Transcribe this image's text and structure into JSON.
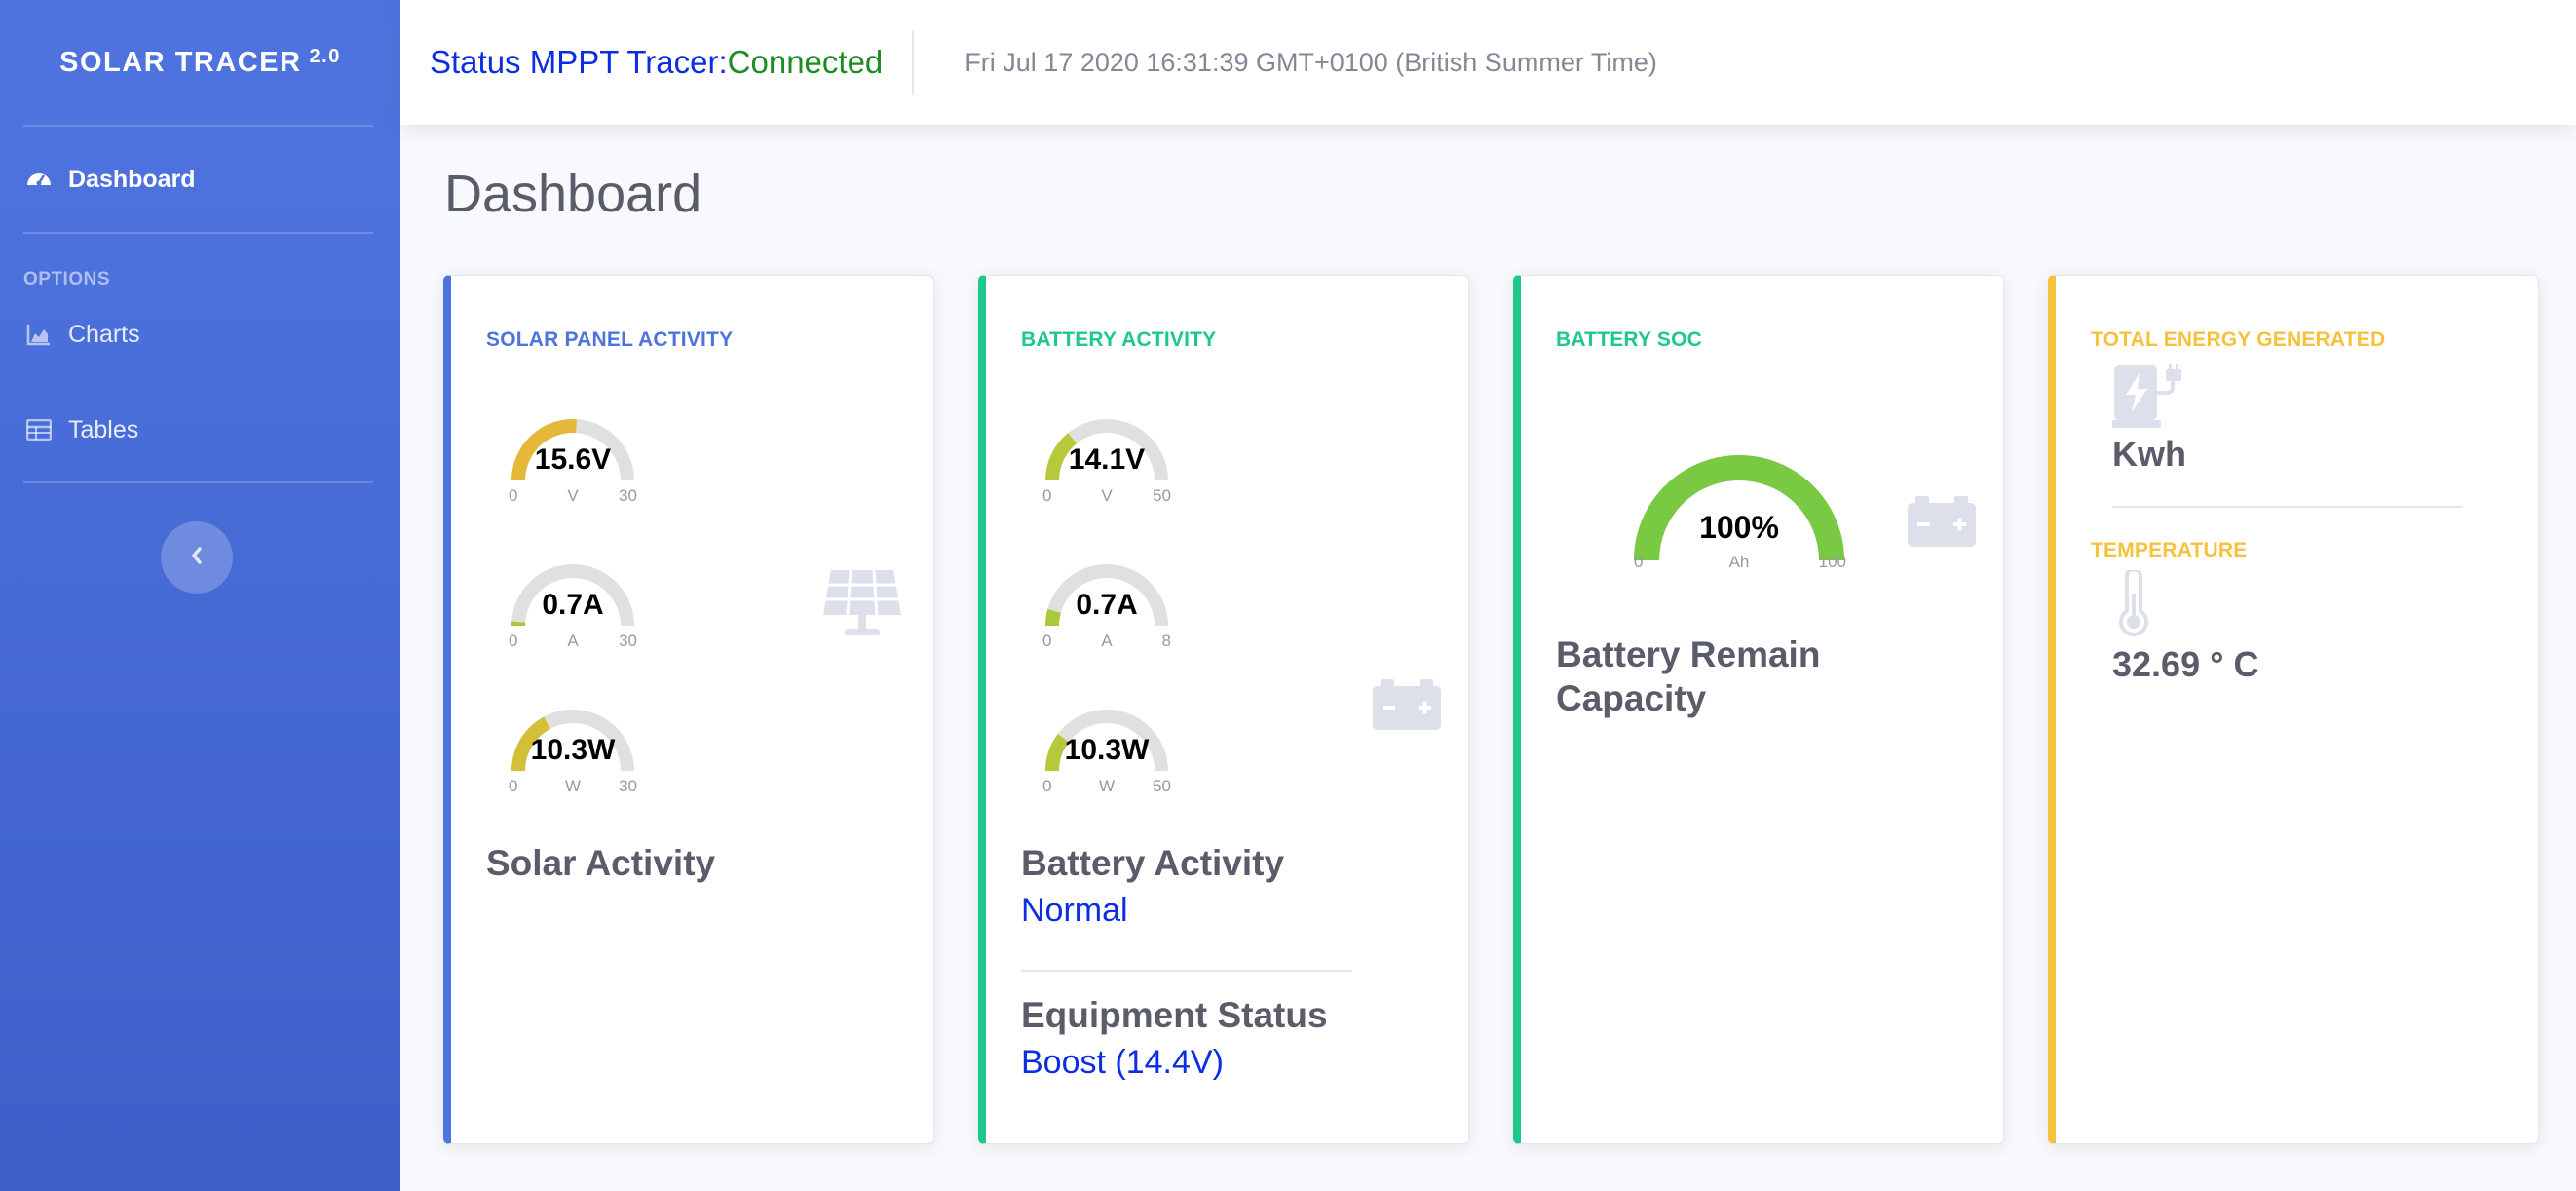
{
  "sidebar": {
    "brand": "SOLAR TRACER",
    "brand_version": "2.0",
    "items": [
      {
        "label": "Dashboard",
        "icon": "tachometer-icon"
      },
      {
        "label": "Charts",
        "icon": "area-chart-icon"
      },
      {
        "label": "Tables",
        "icon": "table-icon"
      }
    ],
    "heading": "OPTIONS",
    "toggle_icon": "chevron-left-icon"
  },
  "topbar": {
    "status_prefix": "Status MPPT Tracer:",
    "status_value": "Connected",
    "datetime": "Fri Jul 17 2020 16:31:39 GMT+0100 (British Summer Time)"
  },
  "page": {
    "title": "Dashboard"
  },
  "cards": {
    "solar": {
      "label": "SOLAR PANEL ACTIVITY",
      "gauges": [
        {
          "value": "15.6V",
          "min": "0",
          "unit": "V",
          "max": "30",
          "fraction": 0.52
        },
        {
          "value": "0.7A",
          "min": "0",
          "unit": "A",
          "max": "30",
          "fraction": 0.023
        },
        {
          "value": "10.3W",
          "min": "0",
          "unit": "W",
          "max": "30",
          "fraction": 0.343
        }
      ],
      "title": "Solar Activity",
      "icon": "solar-panel-icon"
    },
    "battery": {
      "label": "BATTERY ACTIVITY",
      "gauges": [
        {
          "value": "14.1V",
          "min": "0",
          "unit": "V",
          "max": "50",
          "fraction": 0.282
        },
        {
          "value": "0.7A",
          "min": "0",
          "unit": "A",
          "max": "8",
          "fraction": 0.0875
        },
        {
          "value": "10.3W",
          "min": "0",
          "unit": "W",
          "max": "50",
          "fraction": 0.206
        }
      ],
      "title": "Battery Activity",
      "status": "Normal",
      "equipment_title": "Equipment Status",
      "equipment_status": "Boost (14.4V)",
      "icon": "battery-icon"
    },
    "soc": {
      "label": "BATTERY SOC",
      "gauge": {
        "value": "100%",
        "min": "0",
        "unit": "Ah",
        "max": "100",
        "fraction": 1.0
      },
      "title_line1": "Battery Remain",
      "title_line2": "Capacity",
      "icon": "battery-icon"
    },
    "energy": {
      "label": "TOTAL ENERGY GENERATED",
      "energy_value": "Kwh",
      "energy_icon": "charging-station-icon",
      "temp_label": "TEMPERATURE",
      "temp_value": "32.69 ° C",
      "temp_icon": "thermometer-icon"
    }
  },
  "colors": {
    "primary": "#4e73df",
    "success": "#1cc88a",
    "warning": "#f6c23e",
    "gauge_bg": "#e0e0e0"
  }
}
